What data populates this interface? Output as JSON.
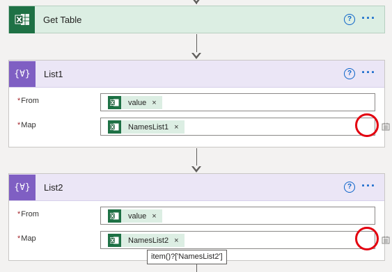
{
  "get_table": {
    "title": "Get Table"
  },
  "list1": {
    "title": "List1",
    "from_label": "From",
    "map_label": "Map",
    "from_token": "value",
    "map_token": "NamesList1"
  },
  "list2": {
    "title": "List2",
    "from_label": "From",
    "map_label": "Map",
    "from_token": "value",
    "map_token": "NamesList2"
  },
  "tooltip": {
    "text": "item()?['NamesList2']"
  },
  "glyphs": {
    "required": "*",
    "help": "?",
    "more": "···",
    "remove": "×",
    "variable": "{∀}"
  },
  "colors": {
    "excel_green": "#1e7145",
    "variable_purple": "#7f5fc3",
    "link_blue": "#0a63c9",
    "highlight_red": "#e3000f"
  }
}
